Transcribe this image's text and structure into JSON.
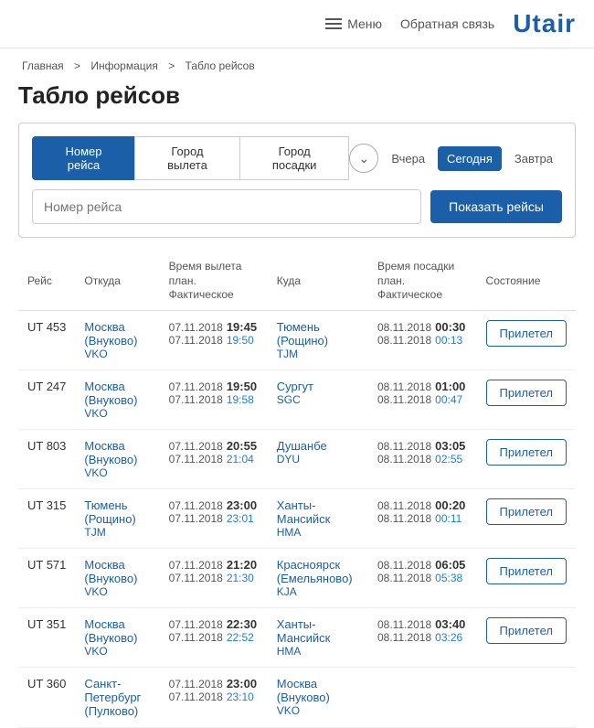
{
  "header": {
    "menu_label": "Меню",
    "feedback_label": "Обратная связь",
    "logo": "Utair"
  },
  "breadcrumb": {
    "items": [
      "Главная",
      "Информация",
      "Табло рейсов"
    ],
    "separators": [
      " > ",
      " > "
    ]
  },
  "page_title": "Табло рейсов",
  "search": {
    "tab1": "Номер рейса",
    "tab2": "Город вылета",
    "tab3": "Город посадки",
    "date_prev": "Вчера",
    "date_today": "Сегодня",
    "date_next": "Завтра",
    "input_placeholder": "Номер рейса",
    "search_btn": "Показать рейсы"
  },
  "table": {
    "headers": {
      "flight": "Рейс",
      "from": "Откуда",
      "dep_time": "Время вылета план. Фактическое",
      "to": "Куда",
      "arr_time": "Время посадки план. Фактическое",
      "status": "Состояние"
    },
    "rows": [
      {
        "flight": "UT 453",
        "from_city": "Москва (Внуково)",
        "from_code": "VKO",
        "dep_date_plan": "07.11.2018",
        "dep_time_plan": "19:45",
        "dep_date_actual": "07.11.2018",
        "dep_time_actual": "19:50",
        "to_city": "Тюмень (Рощино)",
        "to_code": "TJM",
        "arr_date_plan": "08.11.2018",
        "arr_time_plan": "00:30",
        "arr_date_actual": "08.11.2018",
        "arr_time_actual": "00:13",
        "status": "Прилетел"
      },
      {
        "flight": "UT 247",
        "from_city": "Москва (Внуково)",
        "from_code": "VKO",
        "dep_date_plan": "07.11.2018",
        "dep_time_plan": "19:50",
        "dep_date_actual": "07.11.2018",
        "dep_time_actual": "19:58",
        "to_city": "Сургут",
        "to_code": "SGC",
        "arr_date_plan": "08.11.2018",
        "arr_time_plan": "01:00",
        "arr_date_actual": "08.11.2018",
        "arr_time_actual": "00:47",
        "status": "Прилетел"
      },
      {
        "flight": "UT 803",
        "from_city": "Москва (Внуково)",
        "from_code": "VKO",
        "dep_date_plan": "07.11.2018",
        "dep_time_plan": "20:55",
        "dep_date_actual": "07.11.2018",
        "dep_time_actual": "21:04",
        "to_city": "Душанбе",
        "to_code": "DYU",
        "arr_date_plan": "08.11.2018",
        "arr_time_plan": "03:05",
        "arr_date_actual": "08.11.2018",
        "arr_time_actual": "02:55",
        "status": "Прилетел"
      },
      {
        "flight": "UT 315",
        "from_city": "Тюмень (Рощино)",
        "from_code": "TJM",
        "dep_date_plan": "07.11.2018",
        "dep_time_plan": "23:00",
        "dep_date_actual": "07.11.2018",
        "dep_time_actual": "23:01",
        "to_city": "Ханты-Мансийск",
        "to_code": "HMA",
        "arr_date_plan": "08.11.2018",
        "arr_time_plan": "00:20",
        "arr_date_actual": "08.11.2018",
        "arr_time_actual": "00:11",
        "status": "Прилетел"
      },
      {
        "flight": "UT 571",
        "from_city": "Москва (Внуково)",
        "from_code": "VKO",
        "dep_date_plan": "07.11.2018",
        "dep_time_plan": "21:20",
        "dep_date_actual": "07.11.2018",
        "dep_time_actual": "21:30",
        "to_city": "Красноярск (Емельяново)",
        "to_code": "KJA",
        "arr_date_plan": "08.11.2018",
        "arr_time_plan": "06:05",
        "arr_date_actual": "08.11.2018",
        "arr_time_actual": "05:38",
        "status": "Прилетел"
      },
      {
        "flight": "UT 351",
        "from_city": "Москва (Внуково)",
        "from_code": "VKO",
        "dep_date_plan": "07.11.2018",
        "dep_time_plan": "22:30",
        "dep_date_actual": "07.11.2018",
        "dep_time_actual": "22:52",
        "to_city": "Ханты-Мансийск",
        "to_code": "HMA",
        "arr_date_plan": "08.11.2018",
        "arr_time_plan": "03:40",
        "arr_date_actual": "08.11.2018",
        "arr_time_actual": "03:26",
        "status": "Прилетел"
      },
      {
        "flight": "UT 360",
        "from_city": "Санкт-Петербург (Пулково)",
        "from_code": "",
        "dep_date_plan": "07.11.2018",
        "dep_time_plan": "23:00",
        "dep_date_actual": "07.11.2018",
        "dep_time_actual": "23:10",
        "to_city": "Москва (Внуково)",
        "to_code": "VKO",
        "arr_date_plan": "",
        "arr_time_plan": "",
        "arr_date_actual": "",
        "arr_time_actual": "",
        "status": ""
      }
    ]
  }
}
